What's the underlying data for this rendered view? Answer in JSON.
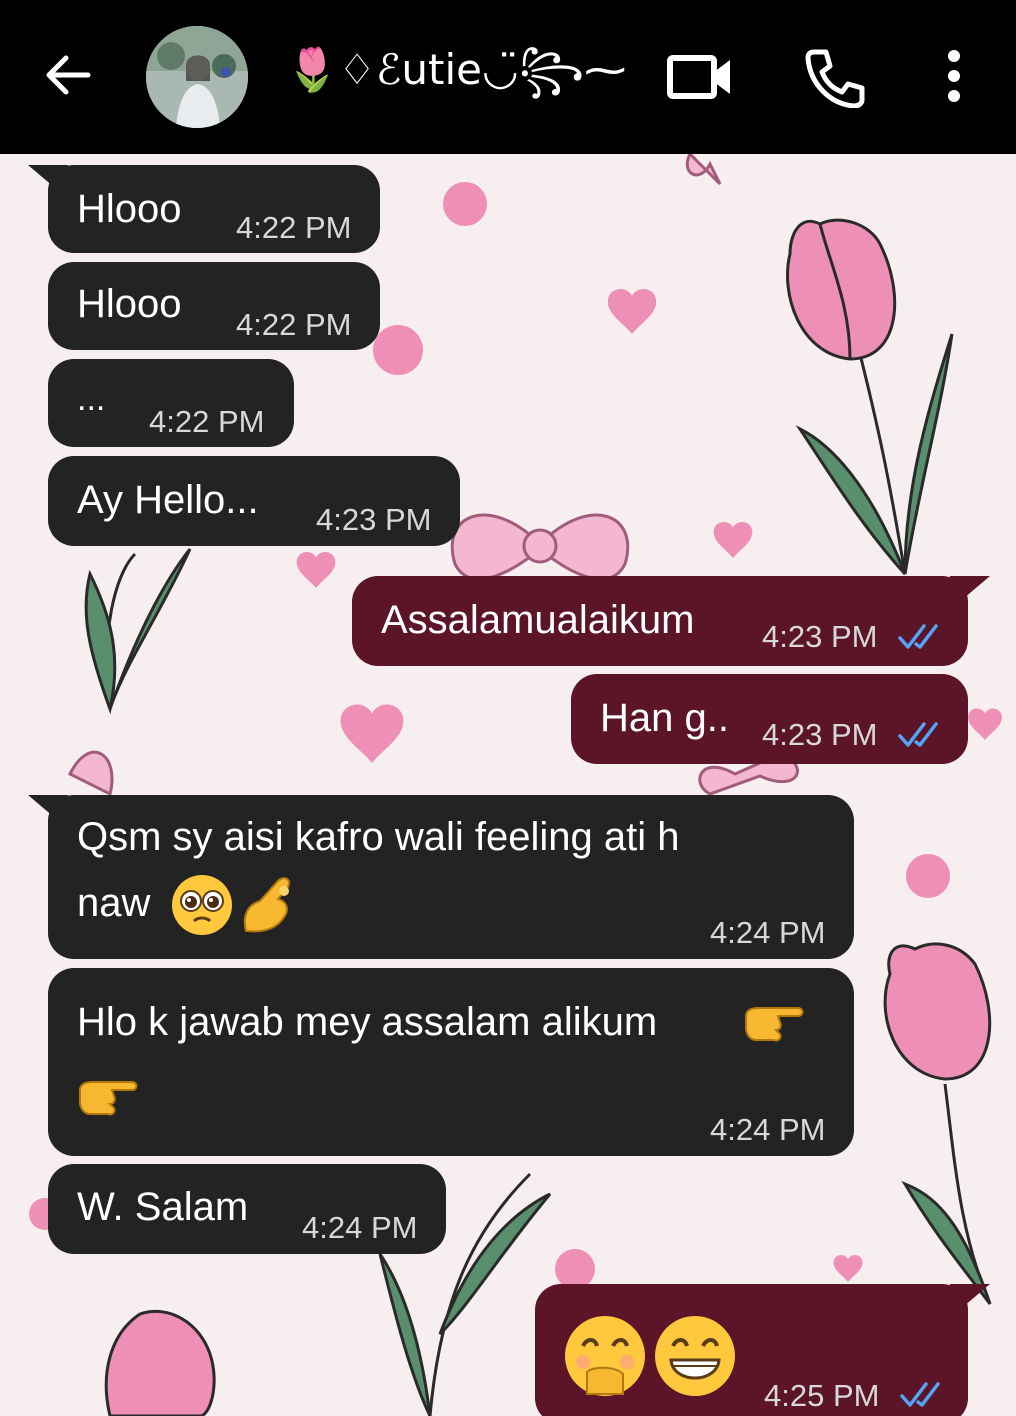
{
  "header": {
    "contact_name": "🌷♢ℰutie◡̈꧂⁓",
    "icons": [
      "back-arrow-icon",
      "avatar",
      "video-call-icon",
      "phone-icon",
      "more-options-icon"
    ]
  },
  "colors": {
    "header_bg": "#000000",
    "incoming_bubble": "#232323",
    "outgoing_bubble": "#5c1429",
    "read_ticks": "#53a6f5",
    "wallpaper_pink": "#ee8fb6",
    "wallpaper_green": "#5a8f6e"
  },
  "messages": [
    {
      "dir": "in",
      "text": "Hlooo",
      "time": "4:22 PM"
    },
    {
      "dir": "in",
      "text": "Hlooo",
      "time": "4:22 PM"
    },
    {
      "dir": "in",
      "text": "...",
      "time": "4:22 PM"
    },
    {
      "dir": "in",
      "text": "Ay Hello...",
      "time": "4:23 PM"
    },
    {
      "dir": "out",
      "text": "Assalamualaikum",
      "time": "4:23 PM",
      "status": "read"
    },
    {
      "dir": "out",
      "text": "Han g..",
      "time": "4:23 PM",
      "status": "read"
    },
    {
      "dir": "in",
      "text_line1": "Qsm sy aisi kafro wali feeling ati h",
      "text_line2": "naw",
      "emojis": [
        "pleading-face",
        "pinching-hand"
      ],
      "time": "4:24 PM"
    },
    {
      "dir": "in",
      "text_line1": "Hlo k jawab mey assalam alikum",
      "emojis": [
        "pointing-right",
        "pointing-right"
      ],
      "time": "4:24 PM"
    },
    {
      "dir": "in",
      "text": "W. Salam",
      "time": "4:24 PM"
    },
    {
      "dir": "out",
      "emojis": [
        "face-with-hand-over-mouth",
        "grinning-face"
      ],
      "time": "4:25 PM",
      "status": "read"
    }
  ]
}
